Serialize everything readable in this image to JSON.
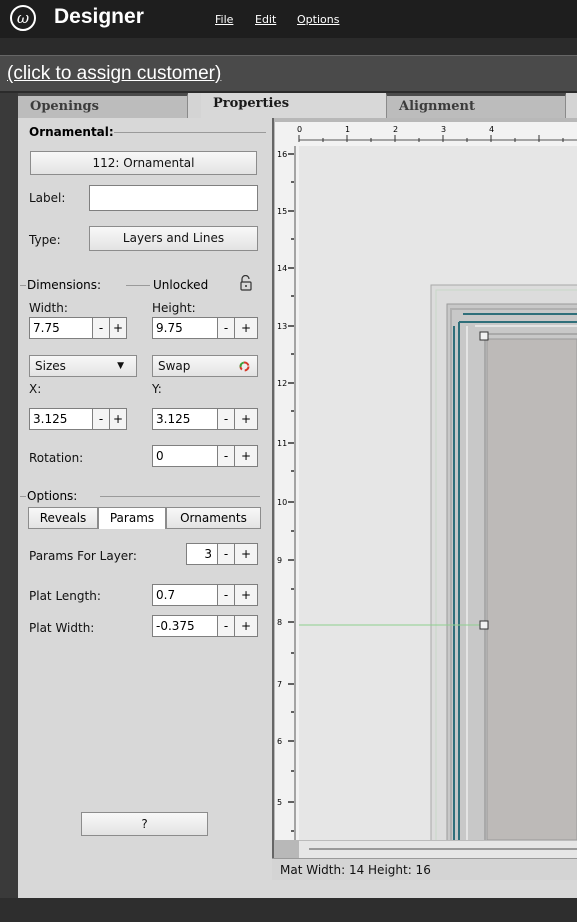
{
  "app": {
    "logo_glyph": "ω",
    "name": "Designer",
    "menu": [
      "File",
      "Edit",
      "Options"
    ]
  },
  "customer_link": "(click to assign customer)",
  "tabs": [
    "Openings",
    "Properties",
    "Alignment"
  ],
  "panel": {
    "section_title": "Ornamental:",
    "ornament_button": "112: Ornamental",
    "label_caption": "Label:",
    "label_value": "",
    "type_caption": "Type:",
    "type_button": "Layers and Lines",
    "dimensions": {
      "title": "Dimensions:",
      "lock_label": "Unlocked",
      "width_caption": "Width:",
      "width_value": "7.75",
      "height_caption": "Height:",
      "height_value": "9.75",
      "sizes_button": "Sizes",
      "swap_button": "Swap",
      "x_caption": "X:",
      "x_value": "3.125",
      "y_caption": "Y:",
      "y_value": "3.125",
      "rotation_caption": "Rotation:",
      "rotation_value": "0"
    },
    "options": {
      "title": "Options:",
      "tabs": [
        "Reveals",
        "Params",
        "Ornaments"
      ],
      "params_for_layer_caption": "Params For Layer:",
      "params_for_layer_value": "3",
      "plat_length_caption": "Plat Length:",
      "plat_length_value": "0.7",
      "plat_width_caption": "Plat Width:",
      "plat_width_value": "-0.375"
    },
    "help_button": "?"
  },
  "ruler": {
    "top_labels": [
      "0",
      "1",
      "2",
      "3",
      "4"
    ],
    "left_labels": [
      "16",
      "15",
      "14",
      "13",
      "12",
      "11",
      "10",
      "9",
      "8",
      "7",
      "6",
      "5"
    ]
  },
  "status": "Mat  Width: 14  Height: 16",
  "colors": {
    "frame_teal": "#2f6f7a",
    "guide_green": "#8fd08f"
  },
  "icons": {
    "lock": "unlock-icon",
    "dropdown": "caret-down-icon",
    "swap": "swap-arrows-icon"
  }
}
